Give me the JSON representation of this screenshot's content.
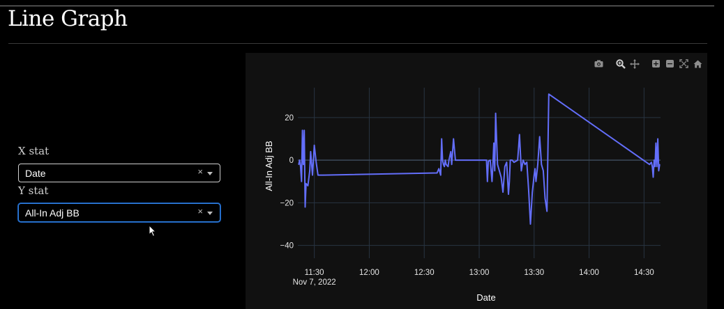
{
  "page": {
    "title": "Line Graph"
  },
  "controls": {
    "x_stat": {
      "label": "X stat",
      "value": "Date",
      "clear_icon": "×"
    },
    "y_stat": {
      "label": "Y stat",
      "value": "All-In Adj BB",
      "clear_icon": "×"
    }
  },
  "modebar": [
    "camera-icon",
    "zoom-icon",
    "pan-icon",
    "zoom-in-icon",
    "zoom-out-icon",
    "autoscale-icon",
    "home-icon"
  ],
  "colors": {
    "line": "#636efa",
    "grid": "#283442",
    "panel": "#111111",
    "background": "#000000",
    "focus": "#2f7fe0"
  },
  "chart_data": {
    "type": "line",
    "xlabel": "Date",
    "ylabel": "All-In Adj BB",
    "x_ticks": [
      "11:30",
      "12:00",
      "12:30",
      "13:00",
      "13:30",
      "14:00",
      "14:30"
    ],
    "x_sublabel": "Nov 7, 2022",
    "y_ticks": [
      20,
      0,
      -20,
      -40
    ],
    "xlim": [
      "2022-11-07 11:21",
      "2022-11-07 14:39"
    ],
    "ylim": [
      -46,
      34
    ],
    "grid": true,
    "series": [
      {
        "x": [
          "2022-11-07 11:21:30",
          "2022-11-07 11:22:00",
          "2022-11-07 11:22:30",
          "2022-11-07 11:23:00",
          "2022-11-07 11:23:30",
          "2022-11-07 11:24:00",
          "2022-11-07 11:24:30",
          "2022-11-07 11:25:00",
          "2022-11-07 11:25:30",
          "2022-11-07 11:26:30",
          "2022-11-07 11:27:30",
          "2022-11-07 11:28:00",
          "2022-11-07 11:29:00",
          "2022-11-07 11:30:00",
          "2022-11-07 11:31:00",
          "2022-11-07 11:32:00",
          "2022-11-07 11:33:00",
          "2022-11-07 11:34:00",
          "2022-11-07 11:35:00",
          "2022-11-07 12:37:00",
          "2022-11-07 12:38:00",
          "2022-11-07 12:39:00",
          "2022-11-07 12:39:30",
          "2022-11-07 12:40:00",
          "2022-11-07 12:40:30",
          "2022-11-07 12:41:00",
          "2022-11-07 12:41:30",
          "2022-11-07 12:42:00",
          "2022-11-07 12:43:00",
          "2022-11-07 12:43:30",
          "2022-11-07 12:44:30",
          "2022-11-07 12:45:00",
          "2022-11-07 12:46:00",
          "2022-11-07 12:47:00",
          "2022-11-07 12:48:00",
          "2022-11-07 13:04:00",
          "2022-11-07 13:04:30",
          "2022-11-07 13:05:00",
          "2022-11-07 13:06:00",
          "2022-11-07 13:07:00",
          "2022-11-07 13:07:30",
          "2022-11-07 13:08:00",
          "2022-11-07 13:08:30",
          "2022-11-07 13:09:00",
          "2022-11-07 13:10:00",
          "2022-11-07 13:11:00",
          "2022-11-07 13:12:00",
          "2022-11-07 13:13:00",
          "2022-11-07 13:14:00",
          "2022-11-07 13:15:00",
          "2022-11-07 13:16:00",
          "2022-11-07 13:16:30",
          "2022-11-07 13:17:00",
          "2022-11-07 13:18:00",
          "2022-11-07 13:19:00",
          "2022-11-07 13:21:00",
          "2022-11-07 13:22:00",
          "2022-11-07 13:23:00",
          "2022-11-07 13:24:00",
          "2022-11-07 13:25:00",
          "2022-11-07 13:26:00",
          "2022-11-07 13:27:00",
          "2022-11-07 13:28:00",
          "2022-11-07 13:29:00",
          "2022-11-07 13:30:00",
          "2022-11-07 13:30:30",
          "2022-11-07 13:31:00",
          "2022-11-07 13:32:00",
          "2022-11-07 13:33:00",
          "2022-11-07 13:34:00",
          "2022-11-07 13:35:00",
          "2022-11-07 13:36:00",
          "2022-11-07 13:37:00",
          "2022-11-07 13:38:00",
          "2022-11-07 14:33:00",
          "2022-11-07 14:34:00",
          "2022-11-07 14:34:30",
          "2022-11-07 14:35:00",
          "2022-11-07 14:35:30",
          "2022-11-07 14:36:00",
          "2022-11-07 14:36:30",
          "2022-11-07 14:37:00",
          "2022-11-07 14:37:30",
          "2022-11-07 14:38:00",
          "2022-11-07 14:38:30"
        ],
        "y": [
          -2,
          0,
          -3,
          -10,
          14,
          -2,
          14,
          -22,
          -11,
          -12,
          -5,
          4,
          -7,
          7,
          -1,
          -7,
          -7,
          -7,
          -7,
          -6,
          -4,
          -7,
          10,
          0,
          -2,
          -3,
          0,
          -2,
          -3,
          0,
          4,
          -2,
          10,
          0,
          0,
          0,
          -10,
          -0.5,
          0,
          -10,
          -2,
          8,
          -5,
          22,
          -2,
          -5,
          -8,
          -15,
          -3,
          -1,
          -16,
          -10,
          0,
          0,
          -1,
          0,
          12,
          -5,
          0,
          -2,
          -1,
          -14,
          -30,
          -15,
          -7,
          -4,
          -10,
          -2,
          11,
          -2,
          -5,
          -18,
          -24,
          31,
          -2,
          -1,
          -3,
          -8,
          0,
          -3,
          8,
          -3,
          10,
          -5,
          -2
        ]
      }
    ]
  }
}
